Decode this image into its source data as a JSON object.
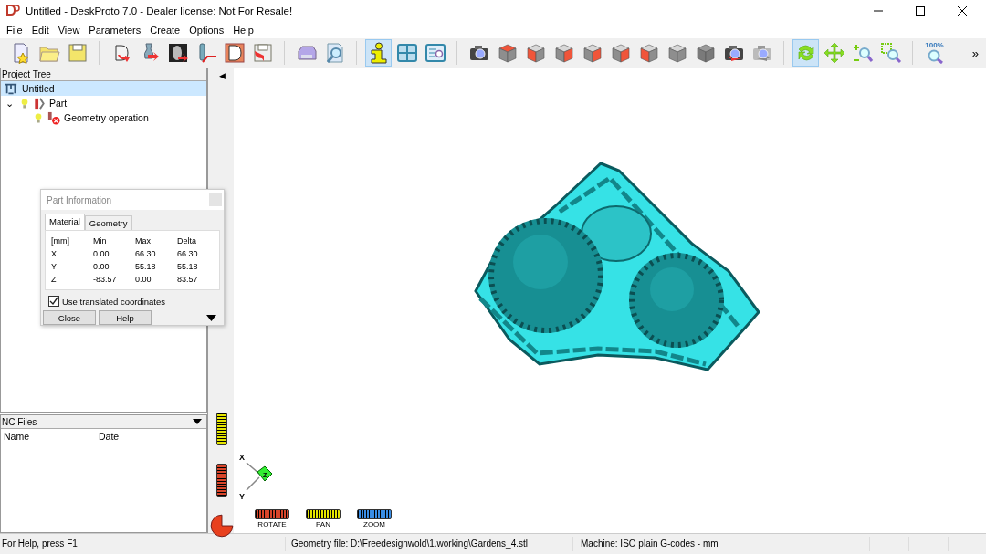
{
  "window": {
    "title": "Untitled - DeskProto 7.0 - Dealer license: Not For Resale!"
  },
  "menu": [
    "File",
    "Edit",
    "View",
    "Parameters",
    "Create",
    "Options",
    "Help"
  ],
  "toolbar": [
    [
      {
        "kind": "new",
        "selected": false
      },
      {
        "kind": "open",
        "selected": false
      },
      {
        "kind": "save",
        "selected": false
      }
    ],
    [
      {
        "kind": "import-d",
        "selected": false
      },
      {
        "kind": "import-vase",
        "selected": false
      },
      {
        "kind": "import-image",
        "selected": false
      },
      {
        "kind": "cutter",
        "selected": false
      },
      {
        "kind": "dxf",
        "selected": false
      },
      {
        "kind": "export",
        "selected": false
      }
    ],
    [
      {
        "kind": "print",
        "selected": false
      },
      {
        "kind": "preview",
        "selected": false
      }
    ],
    [
      {
        "kind": "info",
        "selected": true
      },
      {
        "kind": "layout",
        "selected": false
      },
      {
        "kind": "list-search",
        "selected": false
      }
    ],
    [
      {
        "kind": "camera",
        "selected": false
      },
      {
        "kind": "view-top",
        "selected": false
      },
      {
        "kind": "view-front",
        "selected": false
      },
      {
        "kind": "view-right",
        "selected": false
      },
      {
        "kind": "view-bottom",
        "selected": false
      },
      {
        "kind": "view-back",
        "selected": false
      },
      {
        "kind": "view-left",
        "selected": false
      },
      {
        "kind": "view-iso",
        "selected": false
      },
      {
        "kind": "view-solid",
        "selected": false
      },
      {
        "kind": "camera-back",
        "selected": false
      },
      {
        "kind": "camera-forward",
        "selected": false
      }
    ],
    [
      {
        "kind": "rotate",
        "selected": true
      },
      {
        "kind": "pan",
        "selected": false
      },
      {
        "kind": "zoom",
        "selected": false
      },
      {
        "kind": "zoom-window",
        "selected": false
      }
    ],
    [
      {
        "kind": "zoom-100",
        "label": "100%",
        "selected": false
      }
    ]
  ],
  "toolbar_overflow": "»",
  "project_tree": {
    "title": "Project Tree",
    "items": [
      {
        "label": "Untitled",
        "kind": "project",
        "selected": true,
        "children": [
          {
            "label": "Part",
            "kind": "part",
            "expanded": true,
            "expander": "⌄",
            "selected": false,
            "children": [
              {
                "label": "Geometry operation",
                "kind": "operation",
                "selected": false
              }
            ]
          }
        ]
      }
    ]
  },
  "nc_files": {
    "title": "NC Files",
    "columns": [
      "Name",
      "Date"
    ]
  },
  "viewport": {
    "collapse": "◀",
    "axes": {
      "x": "X",
      "y": "Y",
      "z": "Z"
    },
    "nav": [
      "ROTATE",
      "PAN",
      "ZOOM"
    ]
  },
  "part_information": {
    "title": "Part Information",
    "tabs": [
      {
        "label": "Material",
        "selected": true
      },
      {
        "label": "Geometry",
        "selected": false
      }
    ],
    "columns": [
      "[mm]",
      "Min",
      "Max",
      "Delta"
    ],
    "rows": [
      [
        "X",
        "0.00",
        "66.30",
        "66.30"
      ],
      [
        "Y",
        "0.00",
        "55.18",
        "55.18"
      ],
      [
        "Z",
        "-83.57",
        "0.00",
        "83.57"
      ]
    ],
    "translated": {
      "label": "Use translated coordinates",
      "checked": true
    },
    "buttons": [
      "Close",
      "Help"
    ]
  },
  "status_bar": [
    "For Help, press F1",
    "Geometry file: D:\\Freedesignwold\\1.working\\Gardens_4.stl",
    "Machine: ISO plain G-codes - mm"
  ]
}
